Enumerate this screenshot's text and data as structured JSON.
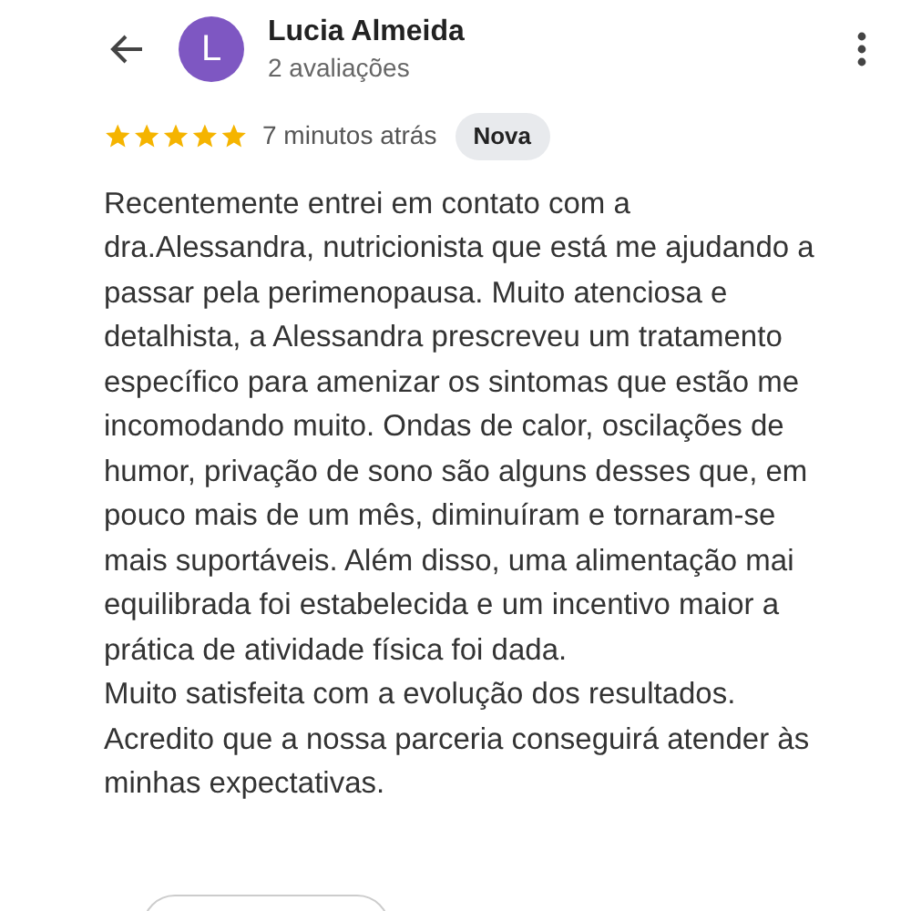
{
  "header": {
    "avatar_letter": "L",
    "name": "Lucia Almeida",
    "subtitle": "2 avaliações"
  },
  "review": {
    "stars": 5,
    "time": "7 minutos atrás",
    "badge": "Nova",
    "text": "Recentemente entrei em contato com a\ndra.Alessandra, nutricionista que está me ajudando a\npassar pela perimenopausa. Muito atenciosa e\ndetalhista, a Alessandra prescreveu um tratamento\nespecífico para amenizar os sintomas que estão me\nincomodando muito. Ondas de calor, oscilações de\nhumor, privação de sono são alguns desses que, em\npouco mais de um mês, diminuíram e tornaram-se\nmais suportáveis. Além disso, uma alimentação mai\nequilibrada foi estabelecida e um incentivo maior a\nprática de atividade física foi dada.\nMuito satisfeita com a evolução dos resultados.\nAcredito que a nossa parceria conseguirá atender às\nminhas expectativas."
  }
}
